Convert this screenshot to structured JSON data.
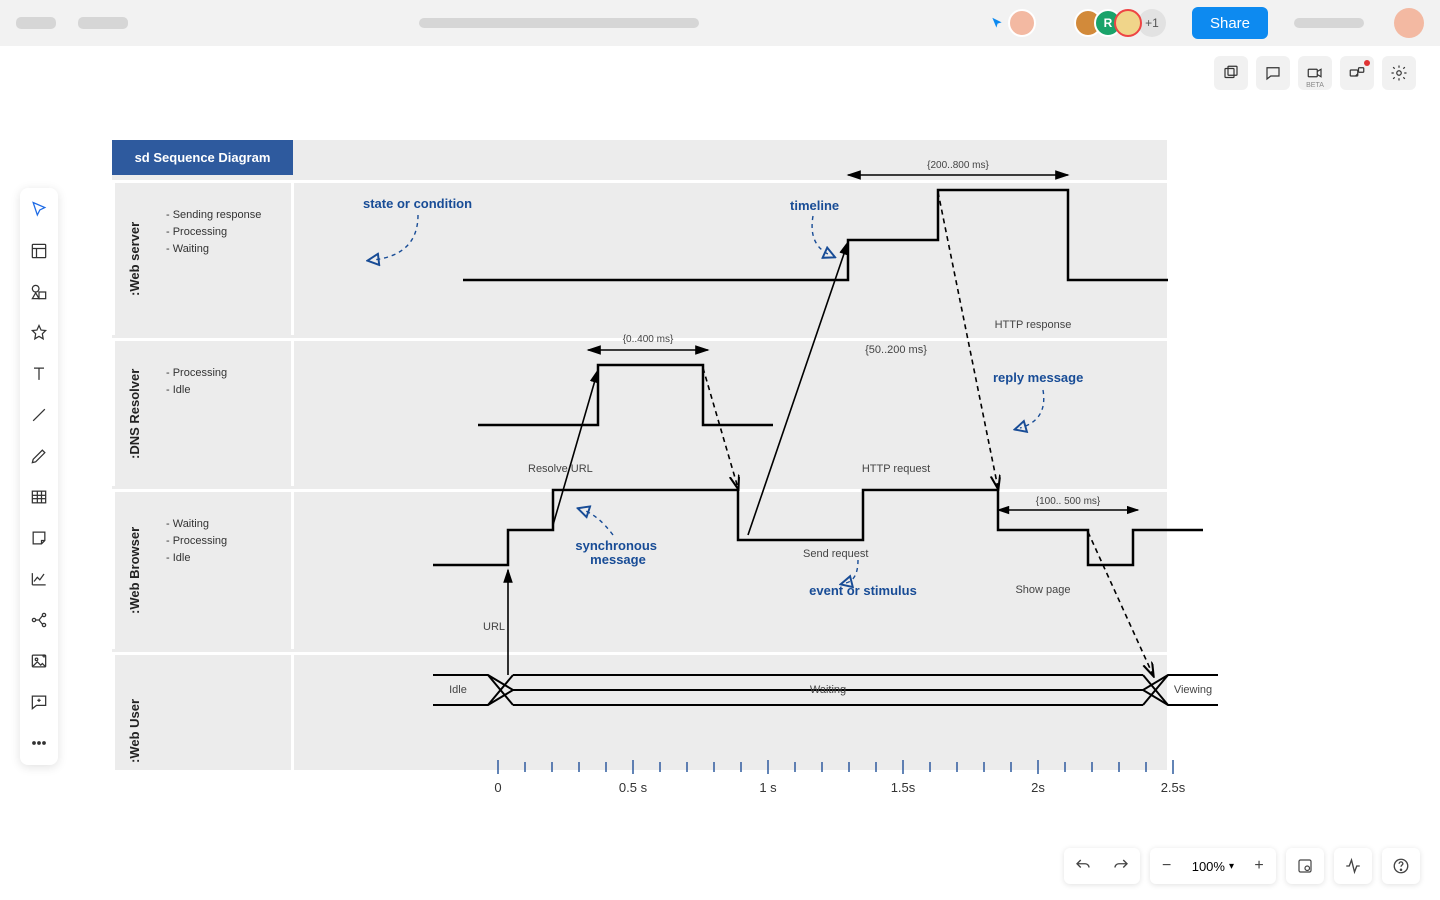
{
  "topbar": {
    "share": "Share",
    "extra_count": "+1"
  },
  "avatars": [
    {
      "bg": "#f3b9a2"
    },
    {
      "bg": "#d28a3a"
    },
    {
      "bg": "#1aa36a",
      "letter": "R"
    },
    {
      "bg": "#f0d58a"
    }
  ],
  "sec_toolbar": {
    "beta": "BETA"
  },
  "diagram": {
    "title": "sd Sequence Diagram",
    "lanes": [
      {
        "name": ":Web server",
        "notes": [
          "- Sending response",
          "- Processing",
          "- Waiting"
        ]
      },
      {
        "name": ":DNS Resolver",
        "notes": [
          "- Processing",
          "- Idle"
        ]
      },
      {
        "name": ":Web Browser",
        "notes": [
          "- Waiting",
          "- Processing",
          "- Idle"
        ]
      },
      {
        "name": ":Web User",
        "notes": []
      }
    ],
    "annotations": {
      "state_or_condition": "state or condition",
      "timeline": "timeline",
      "reply_message": "reply message",
      "synchronous_message": "synchronous\nmessage",
      "event_or_stimulus": "event or stimulus"
    },
    "labels": {
      "range_ws": "{200..800 ms}",
      "range_dns": "{0..400 ms}",
      "range_wb_http": "{50..200 ms}",
      "range_wb_show": "{100.. 500 ms}",
      "http_response": "HTTP response",
      "http_request": "HTTP request",
      "resolve_url": "Resolve URL",
      "send_request": "Send request",
      "show_page": "Show page",
      "url": "URL",
      "idle": "Idle",
      "waiting": "Waiting",
      "viewing": "Viewing"
    },
    "axis": {
      "ticks": [
        "0",
        "0.5 s",
        "1 s",
        "1.5s",
        "2s",
        "2.5s"
      ]
    }
  },
  "bottom": {
    "zoom": "100%"
  }
}
